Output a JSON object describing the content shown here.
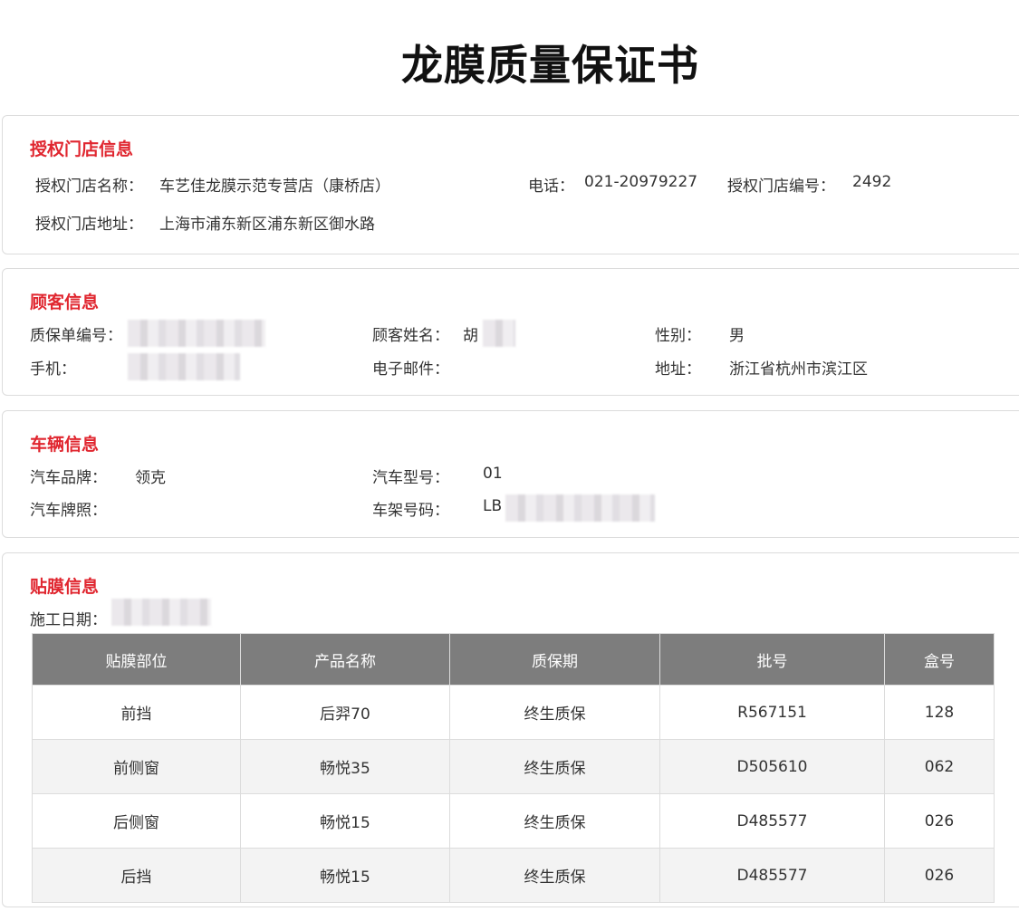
{
  "title": "龙膜质量保证书",
  "store": {
    "heading": "授权门店信息",
    "name_label": "授权门店名称：",
    "name": "车艺佳龙膜示范专营店（康桥店）",
    "phone_label": "电话：",
    "phone": "021-20979227",
    "number_label": "授权门店编号：",
    "number": "2492",
    "address_label": "授权门店地址：",
    "address": "上海市浦东新区浦东新区御水路"
  },
  "customer": {
    "heading": "顾客信息",
    "warranty_no_label": "质保单编号：",
    "name_label": "顾客姓名：",
    "name": "胡",
    "gender_label": "性别：",
    "gender": "男",
    "mobile_label": "手机：",
    "email_label": "电子邮件：",
    "address_label": "地址：",
    "address": "浙江省杭州市滨江区"
  },
  "vehicle": {
    "heading": "车辆信息",
    "brand_label": "汽车品牌：",
    "brand": "领克",
    "model_label": "汽车型号：",
    "model": "01",
    "plate_label": "汽车牌照：",
    "vin_label": "车架号码：",
    "vin": "LB"
  },
  "film": {
    "heading": "贴膜信息",
    "date_label": "施工日期：",
    "columns": [
      "贴膜部位",
      "产品名称",
      "质保期",
      "批号",
      "盒号"
    ],
    "rows": [
      [
        "前挡",
        "后羿70",
        "终生质保",
        "R567151",
        "128"
      ],
      [
        "前侧窗",
        "畅悦35",
        "终生质保",
        "D505610",
        "062"
      ],
      [
        "后侧窗",
        "畅悦15",
        "终生质保",
        "D485577",
        "026"
      ],
      [
        "后挡",
        "畅悦15",
        "终生质保",
        "D485577",
        "026"
      ]
    ]
  },
  "colors": {
    "section_heading": "#e0262f",
    "table_header_bg": "#7d7d7d"
  }
}
